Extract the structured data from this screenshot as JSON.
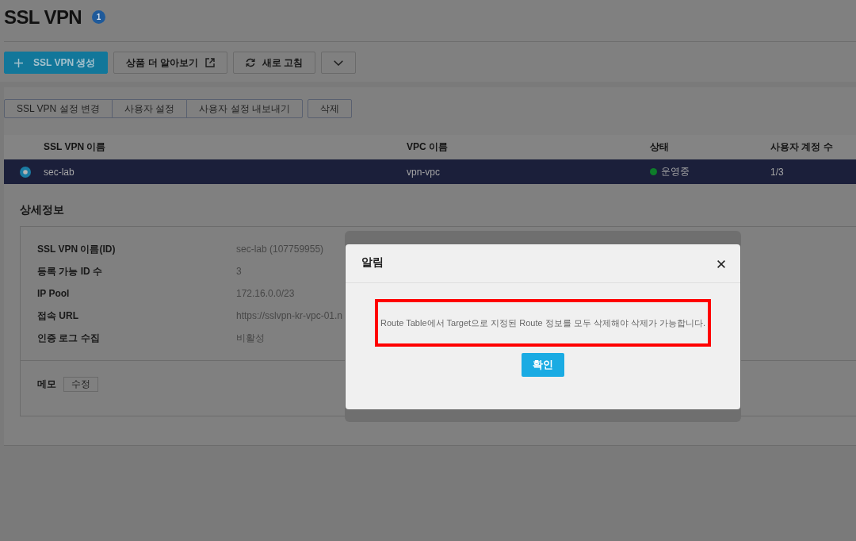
{
  "header": {
    "title": "SSL VPN",
    "count": "1",
    "toolbar": [
      {
        "kind": "primary",
        "label": "SSL VPN 생성"
      },
      {
        "kind": "external",
        "label": "상품 더 알아보기"
      },
      {
        "kind": "refresh",
        "label": "새로 고침"
      },
      {
        "kind": "dropdown"
      }
    ]
  },
  "actions": {
    "group": [
      "SSL VPN 설정 변경",
      "사용자 설정",
      "사용자 설정 내보내기"
    ],
    "delete": "삭제"
  },
  "table": {
    "columns": [
      "SSL VPN 이름",
      "VPC 이름",
      "상태",
      "사용자 계정 수"
    ],
    "rows": [
      {
        "selected": true,
        "name": "sec-lab",
        "vpc": "vpn-vpc",
        "status": {
          "label": "운영중",
          "color": "#0e7c2a"
        },
        "user_accounts": "1/3"
      }
    ]
  },
  "details": {
    "title": "상세정보",
    "fields": [
      {
        "label": "SSL VPN 이름(ID)",
        "value": "sec-lab (107759955)"
      },
      {
        "label": "등록 가능 ID 수",
        "value": "3"
      },
      {
        "label": "IP Pool",
        "value": "172.16.0.0/23"
      },
      {
        "label": "접속 URL",
        "value": "https://sslvpn-kr-vpc-01.n"
      },
      {
        "label": "인증 로그 수집",
        "value": "비활성"
      }
    ],
    "memo": {
      "label": "메모",
      "button": "수정"
    }
  },
  "dialog": {
    "title": "알림",
    "message": "Route Table에서 Target으로 지정된 Route 정보를 모두 삭제해야 삭제가 가능합니다.",
    "highlighted": true,
    "confirm": "확인"
  }
}
